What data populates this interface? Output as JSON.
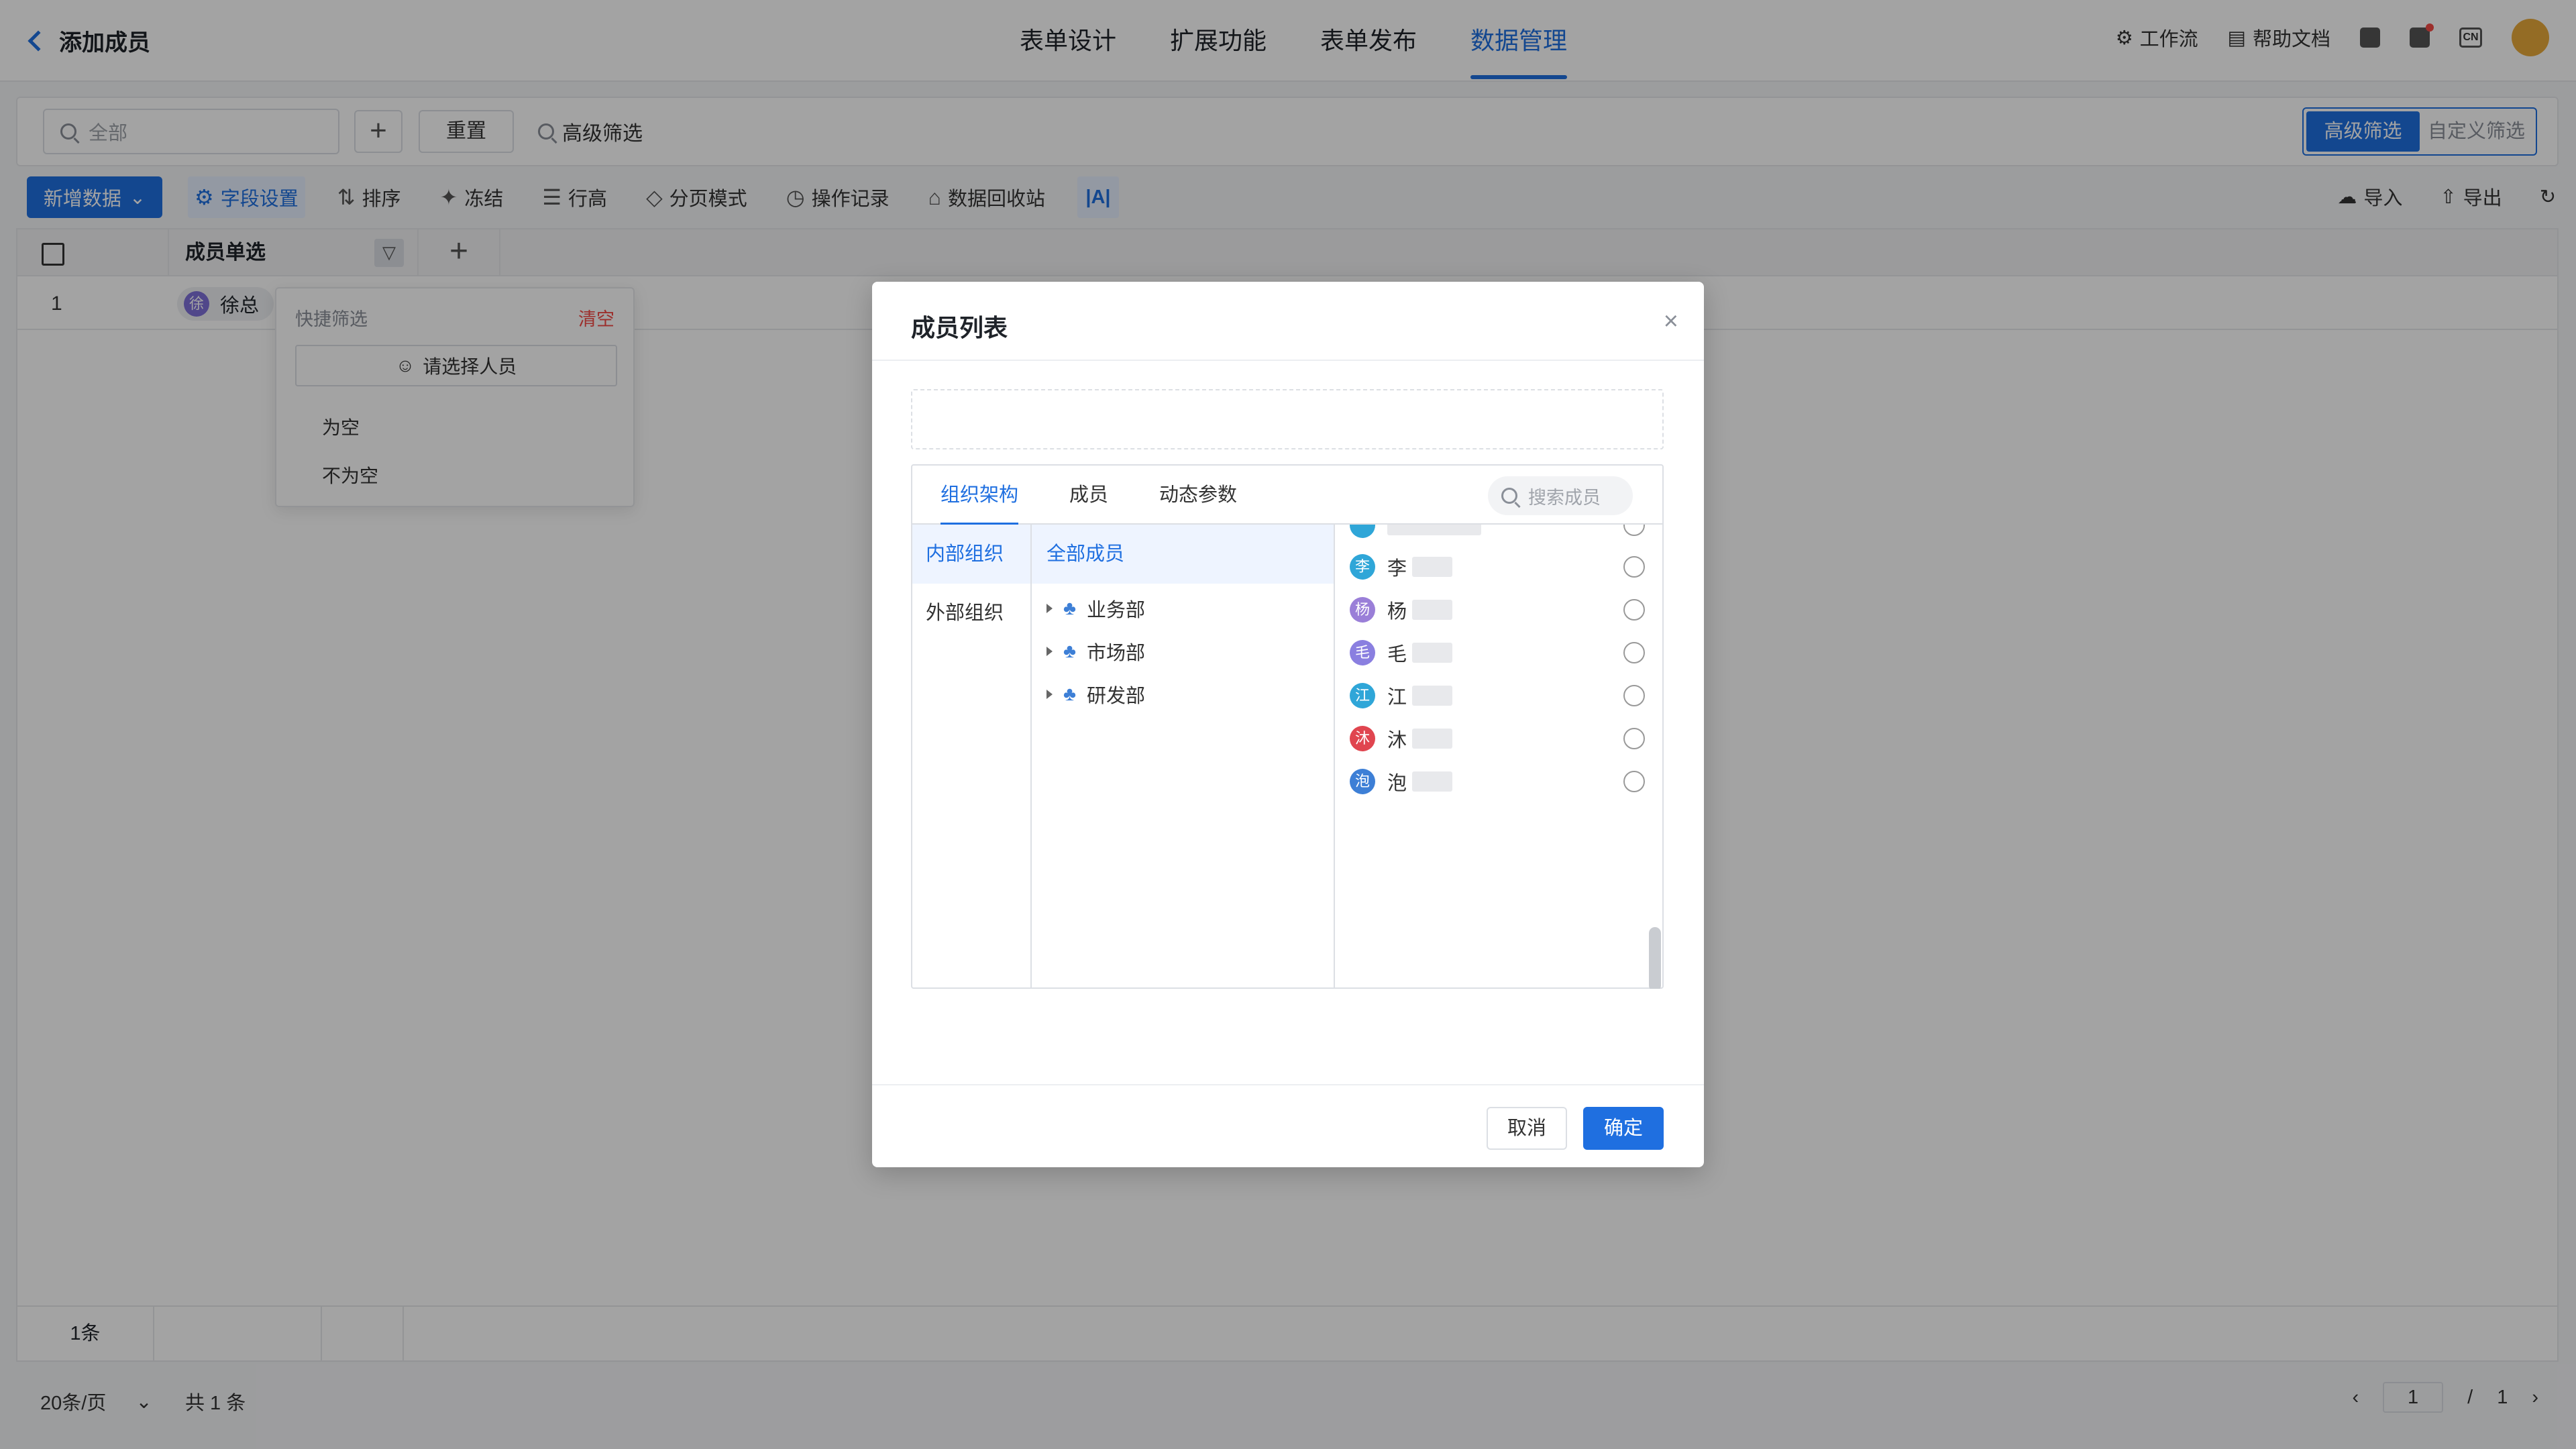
{
  "header": {
    "back_title": "添加成员",
    "tabs": [
      "表单设计",
      "扩展功能",
      "表单发布",
      "数据管理"
    ],
    "active_tab": "数据管理",
    "workflow_label": "工作流",
    "help_label": "帮助文档",
    "lang_label": "CN"
  },
  "filterbar": {
    "search_placeholder": "全部",
    "reset_label": "重置",
    "advanced_label": "高级筛选",
    "segment": [
      "高级筛选",
      "自定义筛选"
    ]
  },
  "toolbar": {
    "new_label": "新增数据",
    "items": [
      "字段设置",
      "排序",
      "冻结",
      "行高",
      "分页模式",
      "操作记录",
      "数据回收站"
    ],
    "text_tool": "|A|",
    "import_label": "导入",
    "export_label": "导出"
  },
  "table": {
    "column": "成员单选",
    "rows": [
      {
        "index": "1",
        "avatar_char": "徐",
        "name": "徐总"
      }
    ],
    "footer_count": "1条"
  },
  "pagination": {
    "per_page": "20条/页",
    "total": "共 1 条",
    "page": "1",
    "separator": "/",
    "pages": "1"
  },
  "quick_filter": {
    "title": "快捷筛选",
    "clear": "清空",
    "select_placeholder": "请选择人员",
    "options": [
      "为空",
      "不为空"
    ]
  },
  "modal": {
    "title": "成员列表",
    "tabs": [
      "组织架构",
      "成员",
      "动态参数"
    ],
    "search_placeholder": "搜索成员",
    "org_types": [
      "内部组织",
      "外部组织"
    ],
    "all_members": "全部成员",
    "departments": [
      "业务部",
      "市场部",
      "研发部"
    ],
    "members": [
      {
        "char": "李",
        "name": "李",
        "color": "#2fa6d8"
      },
      {
        "char": "杨",
        "name": "杨",
        "color": "#9a7fd8"
      },
      {
        "char": "毛",
        "name": "毛",
        "color": "#8a7fe0"
      },
      {
        "char": "江",
        "name": "江",
        "color": "#2fa6d8"
      },
      {
        "char": "沐",
        "name": "沐",
        "color": "#e0454f"
      },
      {
        "char": "泡",
        "name": "泡",
        "color": "#3d7fd6"
      }
    ],
    "cancel": "取消",
    "confirm": "确定"
  },
  "colors": {
    "accent": "#1f6fe0",
    "danger": "#f54a45"
  }
}
